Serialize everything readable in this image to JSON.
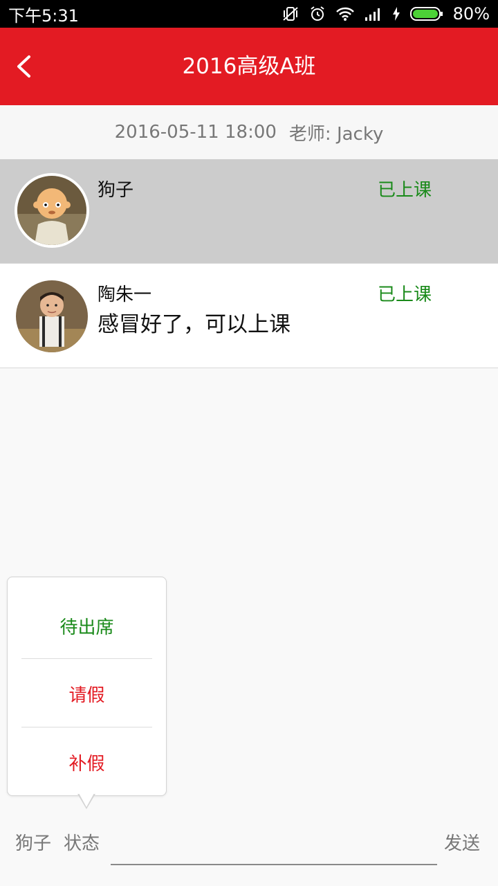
{
  "status_bar": {
    "time": "下午5:31",
    "battery": "80%"
  },
  "header": {
    "title": "2016高级A班"
  },
  "session": {
    "datetime": "2016-05-11 18:00",
    "teacher": "老师: Jacky"
  },
  "students": [
    {
      "name": "狗子",
      "status": "已上课",
      "note": ""
    },
    {
      "name": "陶朱一",
      "status": "已上课",
      "note": "感冒好了，可以上课"
    }
  ],
  "popup_menu": {
    "items": [
      {
        "label": "待出席",
        "color": "#1a8a1a"
      },
      {
        "label": "请假",
        "color": "#e31b23"
      },
      {
        "label": "补假",
        "color": "#e31b23"
      }
    ]
  },
  "composer": {
    "name": "狗子",
    "status_label": "状态",
    "input_value": "",
    "send_label": "发送"
  },
  "colors": {
    "brand_red": "#e31b23",
    "status_green": "#1a8a1a",
    "selected_row": "#cccccc"
  }
}
